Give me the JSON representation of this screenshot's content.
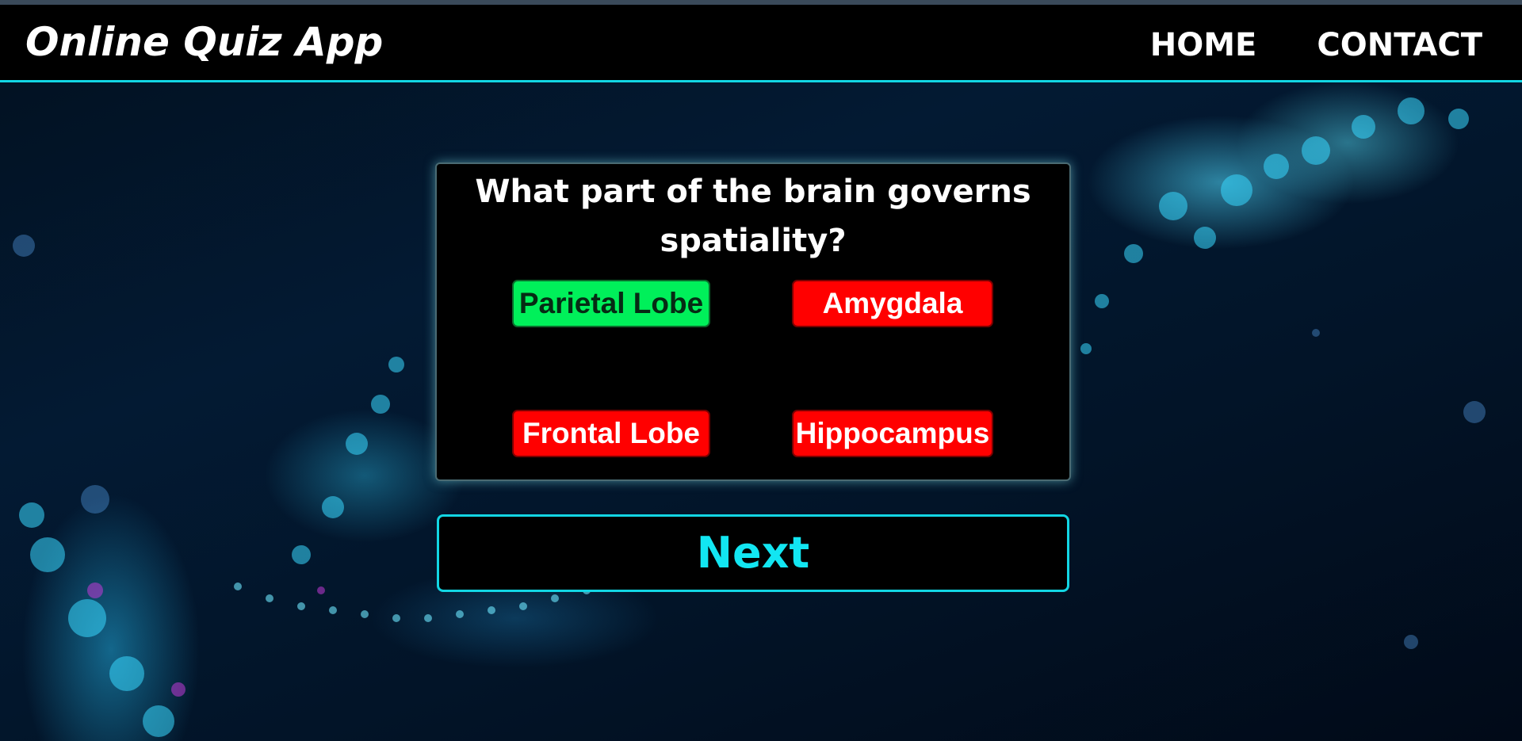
{
  "app": {
    "title": "Online Quiz App"
  },
  "nav": {
    "items": [
      {
        "label": "HOME"
      },
      {
        "label": "CONTACT"
      }
    ]
  },
  "quiz": {
    "question": "What part of the brain governs spatiality?",
    "answers": [
      {
        "label": "Parietal Lobe",
        "state": "correct"
      },
      {
        "label": "Amygdala",
        "state": "incorrect"
      },
      {
        "label": "Frontal Lobe",
        "state": "incorrect"
      },
      {
        "label": "Hippocampus",
        "state": "incorrect"
      }
    ],
    "next_label": "Next"
  },
  "colors": {
    "accent": "#12d6e4",
    "correct": "#00f05a",
    "incorrect": "#ff0000",
    "panel": "#000000"
  }
}
